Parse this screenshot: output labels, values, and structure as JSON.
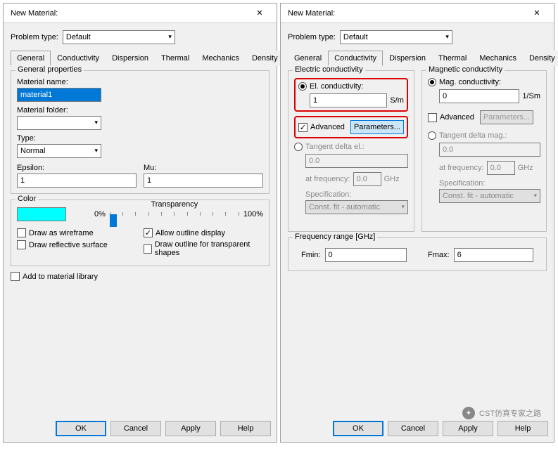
{
  "dialog_title": "New Material:",
  "close_glyph": "✕",
  "problem_type_label": "Problem type:",
  "problem_type_value": "Default",
  "tabs": [
    "General",
    "Conductivity",
    "Dispersion",
    "Thermal",
    "Mechanics",
    "Density"
  ],
  "general": {
    "group_title": "General properties",
    "name_label": "Material name:",
    "name_value": "material1",
    "folder_label": "Material folder:",
    "folder_value": "",
    "type_label": "Type:",
    "type_value": "Normal",
    "epsilon_label": "Epsilon:",
    "epsilon_value": "1",
    "mu_label": "Mu:",
    "mu_value": "1"
  },
  "color": {
    "legend": "Color",
    "t0": "0%",
    "trans_label": "Transparency",
    "t100": "100%",
    "wire": "Draw as wireframe",
    "reflect": "Draw reflective surface",
    "allow": "Allow outline display",
    "outline": "Draw outline for transparent shapes"
  },
  "addlib": "Add to material library",
  "cond": {
    "el_legend": "Electric conductivity",
    "el_radio": "El. conductivity:",
    "el_value": "1",
    "el_unit": "S/m",
    "adv": "Advanced",
    "params": "Parameters...",
    "tan_el": "Tangent delta el.:",
    "tan_el_val": "0.0",
    "atfreq": "at frequency:",
    "atfreq_val": "0.0",
    "ghz": "GHz",
    "spec": "Specification:",
    "spec_val": "Const. fit - automatic",
    "mag_legend": "Magnetic conductivity",
    "mag_radio": "Mag. conductivity:",
    "mag_value": "0",
    "mag_unit": "1/Sm",
    "tan_mag": "Tangent delta mag.:",
    "freq_legend": "Frequency range [GHz]",
    "fmin_label": "Fmin:",
    "fmin": "0",
    "fmax_label": "Fmax:",
    "fmax": "6"
  },
  "buttons": {
    "ok": "OK",
    "cancel": "Cancel",
    "apply": "Apply",
    "help": "Help"
  },
  "watermark": "CST仿真专家之路",
  "chev": "▾",
  "check": "✓"
}
